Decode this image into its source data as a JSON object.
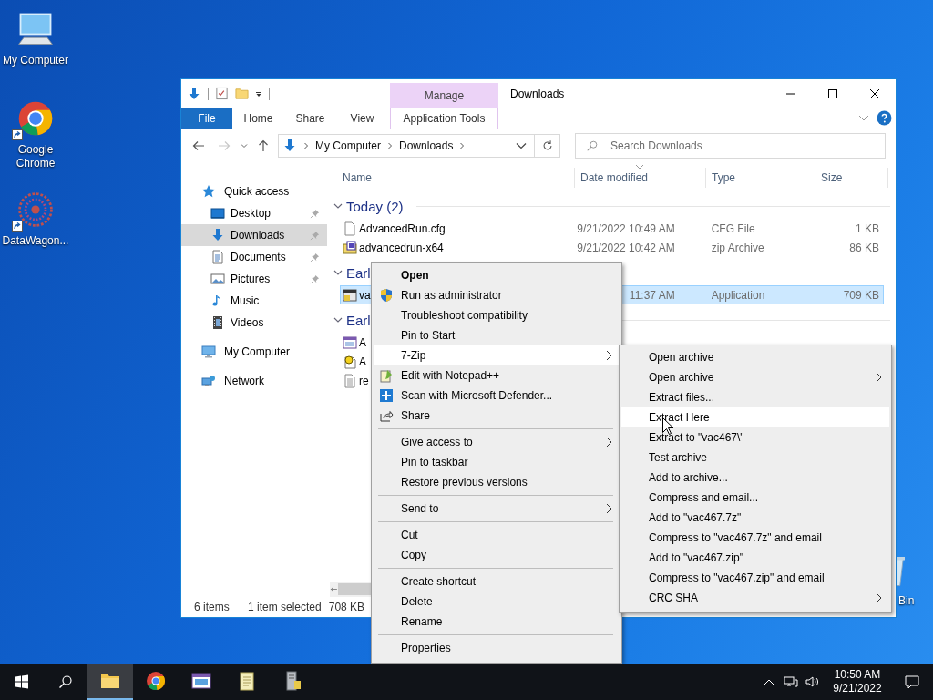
{
  "desktop_icons": [
    {
      "label": "My Computer",
      "kind": "computer",
      "shortcut": false
    },
    {
      "label": "Google Chrome",
      "kind": "browser",
      "shortcut": true
    },
    {
      "label": "DataWagon...",
      "kind": "wheel",
      "shortcut": true
    }
  ],
  "recycle_bin": {
    "label": "Bin"
  },
  "explorer": {
    "title": "Downloads",
    "context_group": "Manage",
    "ribbon_tabs": [
      {
        "label": "File",
        "kind": "file"
      },
      {
        "label": "Home",
        "kind": "tab"
      },
      {
        "label": "Share",
        "kind": "tab"
      },
      {
        "label": "View",
        "kind": "tab"
      },
      {
        "label": "Application Tools",
        "kind": "contextual"
      }
    ],
    "breadcrumb": [
      "My Computer",
      "Downloads"
    ],
    "search": {
      "placeholder": "Search Downloads"
    },
    "sidebar": [
      {
        "label": "Quick access",
        "kind": "star",
        "selected": false,
        "children": [
          {
            "label": "Desktop",
            "kind": "desktop",
            "pinned": true,
            "selected": false
          },
          {
            "label": "Downloads",
            "kind": "download",
            "pinned": true,
            "selected": true
          },
          {
            "label": "Documents",
            "kind": "document",
            "pinned": true,
            "selected": false
          },
          {
            "label": "Pictures",
            "kind": "picture",
            "pinned": true,
            "selected": false
          },
          {
            "label": "Music",
            "kind": "music",
            "pinned": false,
            "selected": false
          },
          {
            "label": "Videos",
            "kind": "video",
            "pinned": false,
            "selected": false
          }
        ]
      },
      {
        "label": "My Computer",
        "kind": "computer",
        "selected": false
      },
      {
        "label": "Network",
        "kind": "network",
        "selected": false
      }
    ],
    "columns": [
      {
        "label": "Name",
        "sorted": false
      },
      {
        "label": "Date modified",
        "sorted": true
      },
      {
        "label": "Type",
        "sorted": false
      },
      {
        "label": "Size",
        "sorted": false
      }
    ],
    "groups": [
      {
        "header": "Today (2)",
        "rows": [
          {
            "name": "AdvancedRun.cfg",
            "kind": "file",
            "date": "9/21/2022 10:49 AM",
            "type": "CFG File",
            "size": "1 KB",
            "selected": false
          },
          {
            "name": "advancedrun-x64",
            "kind": "archive",
            "date": "9/21/2022 10:42 AM",
            "type": "zip Archive",
            "size": "86 KB",
            "selected": false
          }
        ]
      },
      {
        "header": "Earl",
        "rows": [
          {
            "name": "va",
            "kind": "app",
            "date": "11:37 AM",
            "type": "Application",
            "size": "709 KB",
            "selected": true
          }
        ]
      },
      {
        "header": "Earl",
        "rows": [
          {
            "name": "A",
            "kind": "window",
            "selected": false
          },
          {
            "name": "A",
            "kind": "helpdoc",
            "selected": false
          },
          {
            "name": "re",
            "kind": "text",
            "selected": false
          }
        ]
      }
    ],
    "status": {
      "items": "6 items",
      "selection": "1 item selected",
      "size": "708 KB"
    }
  },
  "context_menu": {
    "sections": [
      {
        "items": [
          {
            "label": "Open",
            "kind": "plain",
            "default": true,
            "submenu": false,
            "selected": false
          },
          {
            "label": "Run as administrator",
            "kind": "shield",
            "default": false,
            "submenu": false,
            "selected": false
          },
          {
            "label": "Troubleshoot compatibility",
            "kind": "plain",
            "default": false,
            "submenu": false,
            "selected": false
          },
          {
            "label": "Pin to Start",
            "kind": "plain",
            "default": false,
            "submenu": false,
            "selected": false
          },
          {
            "label": "7-Zip",
            "kind": "plain",
            "default": false,
            "submenu": true,
            "selected": true
          },
          {
            "label": "Edit with Notepad++",
            "kind": "notepad",
            "default": false,
            "submenu": false,
            "selected": false
          },
          {
            "label": "Scan with Microsoft Defender...",
            "kind": "defender",
            "default": false,
            "submenu": false,
            "selected": false
          },
          {
            "label": "Share",
            "kind": "share",
            "default": false,
            "submenu": false,
            "selected": false
          }
        ]
      },
      {
        "items": [
          {
            "label": "Give access to",
            "kind": "plain",
            "default": false,
            "submenu": true,
            "selected": false
          },
          {
            "label": "Pin to taskbar",
            "kind": "plain",
            "default": false,
            "submenu": false,
            "selected": false
          },
          {
            "label": "Restore previous versions",
            "kind": "plain",
            "default": false,
            "submenu": false,
            "selected": false
          }
        ]
      },
      {
        "items": [
          {
            "label": "Send to",
            "kind": "plain",
            "default": false,
            "submenu": true,
            "selected": false
          }
        ]
      },
      {
        "items": [
          {
            "label": "Cut",
            "kind": "plain",
            "default": false,
            "submenu": false,
            "selected": false
          },
          {
            "label": "Copy",
            "kind": "plain",
            "default": false,
            "submenu": false,
            "selected": false
          }
        ]
      },
      {
        "items": [
          {
            "label": "Create shortcut",
            "kind": "plain",
            "default": false,
            "submenu": false,
            "selected": false
          },
          {
            "label": "Delete",
            "kind": "plain",
            "default": false,
            "submenu": false,
            "selected": false
          },
          {
            "label": "Rename",
            "kind": "plain",
            "default": false,
            "submenu": false,
            "selected": false
          }
        ]
      },
      {
        "items": [
          {
            "label": "Properties",
            "kind": "plain",
            "default": false,
            "submenu": false,
            "selected": false
          }
        ]
      }
    ]
  },
  "zip_submenu": {
    "items": [
      {
        "label": "Open archive",
        "submenu": false,
        "selected": false
      },
      {
        "label": "Open archive",
        "submenu": true,
        "selected": false
      },
      {
        "label": "Extract files...",
        "submenu": false,
        "selected": false
      },
      {
        "label": "Extract Here",
        "submenu": false,
        "selected": true
      },
      {
        "label": "Extract to \"vac467\\\"",
        "submenu": false,
        "selected": false
      },
      {
        "label": "Test archive",
        "submenu": false,
        "selected": false
      },
      {
        "label": "Add to archive...",
        "submenu": false,
        "selected": false
      },
      {
        "label": "Compress and email...",
        "submenu": false,
        "selected": false
      },
      {
        "label": "Add to \"vac467.7z\"",
        "submenu": false,
        "selected": false
      },
      {
        "label": "Compress to \"vac467.7z\" and email",
        "submenu": false,
        "selected": false
      },
      {
        "label": "Add to \"vac467.zip\"",
        "submenu": false,
        "selected": false
      },
      {
        "label": "Compress to \"vac467.zip\" and email",
        "submenu": false,
        "selected": false
      },
      {
        "label": "CRC SHA",
        "submenu": true,
        "selected": false
      }
    ]
  },
  "taskbar": {
    "apps": [
      {
        "kind": "folder",
        "active": true
      },
      {
        "kind": "browser",
        "active": false
      },
      {
        "kind": "window",
        "active": false
      },
      {
        "kind": "notepad",
        "active": false
      },
      {
        "kind": "server",
        "active": false
      }
    ],
    "time": "10:50 AM",
    "date": "9/21/2022"
  }
}
